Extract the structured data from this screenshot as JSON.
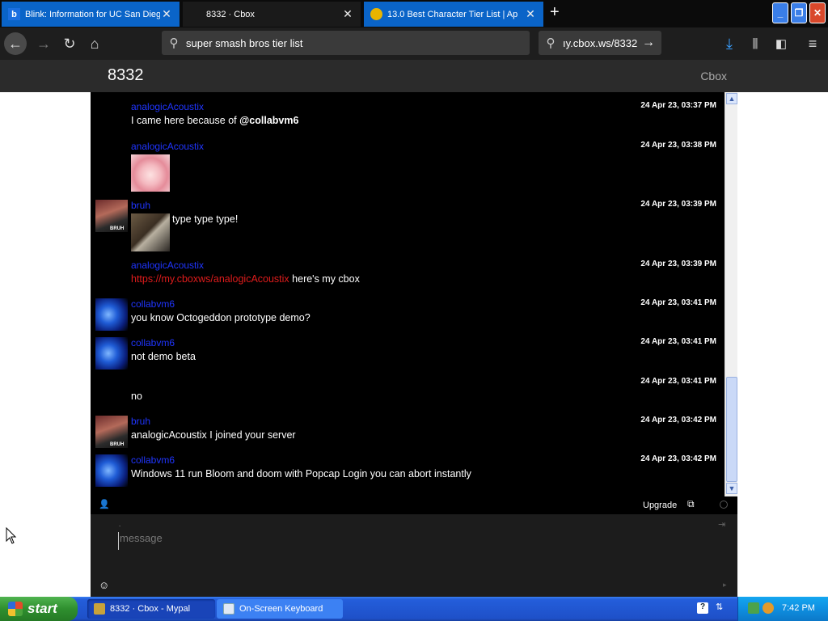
{
  "browser": {
    "tabs": [
      {
        "title": "Blink: Information for UC San Dieg",
        "favicon": "b",
        "active": false
      },
      {
        "title": "8332 · Cbox",
        "favicon": "",
        "active": true
      },
      {
        "title": "13.0 Best Character Tier List | Ap",
        "favicon": "",
        "active": false
      }
    ],
    "search_text": "super smash bros tier list",
    "url_text": "ıy.cbox.ws/8332"
  },
  "page": {
    "title": "8332",
    "brand": "Cbox"
  },
  "messages": [
    {
      "user": "analogicAcoustix",
      "time": "24 Apr 23, 03:37 PM",
      "text_pre": "I came here because of ",
      "text_bold": "@collabvm6",
      "avatar": "none"
    },
    {
      "user": "analogicAcoustix",
      "time": "24 Apr 23, 03:38 PM",
      "avatar": "none",
      "image": "anime-girl-image"
    },
    {
      "user": "bruh",
      "time": "24 Apr 23, 03:39 PM",
      "text": "type type type!",
      "avatar": "bruh",
      "image": "cat-typing-image"
    },
    {
      "user": "analogicAcoustix",
      "time": "24 Apr 23, 03:39 PM",
      "link": "https://my.cboxws/analogicAcoustix",
      "text": " here's my cbox",
      "avatar": "none"
    },
    {
      "user": "collabvm6",
      "time": "24 Apr 23, 03:41 PM",
      "text": "you know Octogeddon prototype demo?",
      "avatar": "collab"
    },
    {
      "user": "collabvm6",
      "time": "24 Apr 23, 03:41 PM",
      "text": "not demo beta",
      "avatar": "collab"
    },
    {
      "user": "",
      "time": "24 Apr 23, 03:41 PM",
      "text": "no",
      "avatar": "none"
    },
    {
      "user": "bruh",
      "time": "24 Apr 23, 03:42 PM",
      "text": "analogicAcoustix I joined your server",
      "avatar": "bruh"
    },
    {
      "user": "collabvm6",
      "time": "24 Apr 23, 03:42 PM",
      "text": "Windows 11 run Bloom and doom with Popcap Login you can abort instantly",
      "avatar": "collab"
    }
  ],
  "footer": {
    "upgrade_label": "Upgrade",
    "message_placeholder": "message"
  },
  "taskbar": {
    "start_label": "start",
    "tasks": [
      {
        "label": "8332 · Cbox - Mypal",
        "active": true
      },
      {
        "label": "On-Screen Keyboard",
        "active": false
      }
    ],
    "clock": "7:42 PM"
  },
  "colors": {
    "username": "#1f35ff",
    "link": "#e01c1c",
    "chat_bg": "#000000",
    "taskbar_blue": "#245edb",
    "start_green": "#2f8f2f"
  }
}
